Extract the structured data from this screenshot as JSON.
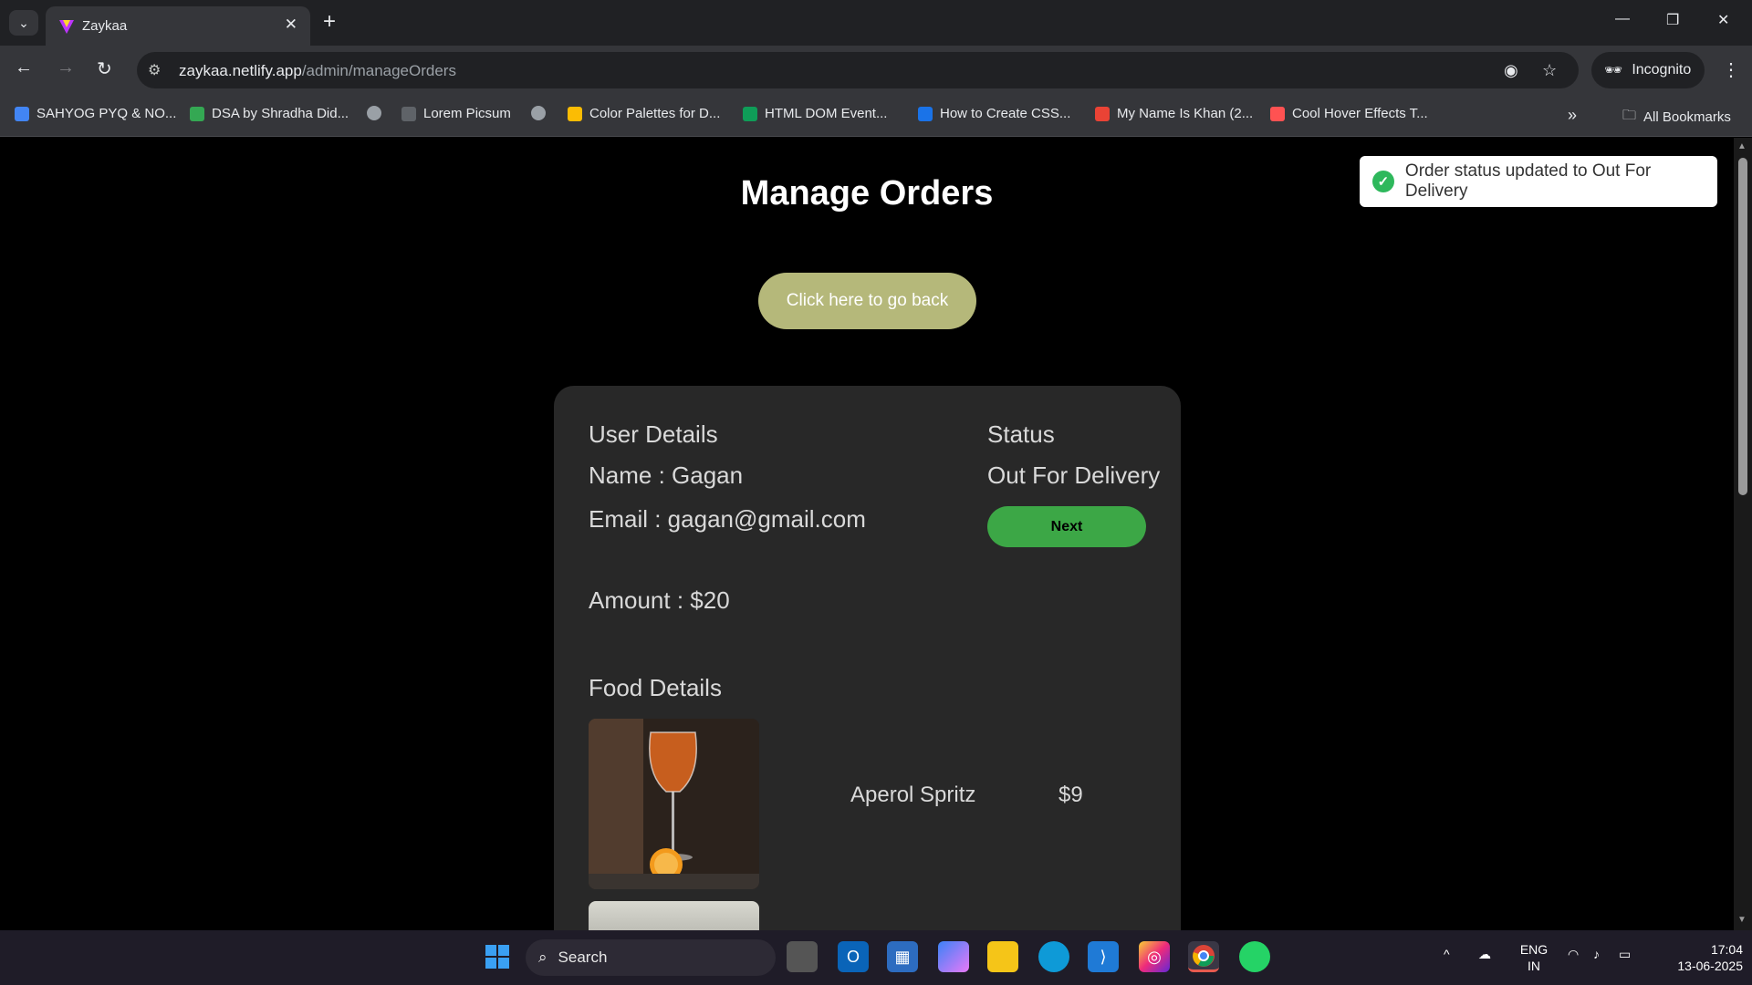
{
  "browser": {
    "tab_title": "Zaykaa",
    "url_host": "zaykaa.netlify.app",
    "url_path": "/admin/manageOrders",
    "incognito_label": "Incognito",
    "all_bookmarks_label": "All Bookmarks",
    "bookmarks": [
      {
        "label": "SAHYOG PYQ & NO...",
        "color": "#4285f4"
      },
      {
        "label": "DSA by Shradha Did...",
        "color": "#34a853"
      },
      {
        "label": "",
        "color": "#9aa0a6"
      },
      {
        "label": "Lorem Picsum",
        "color": "#5f6368"
      },
      {
        "label": "",
        "color": "#9aa0a6"
      },
      {
        "label": "Color Palettes for D...",
        "color": "#fbbc04"
      },
      {
        "label": "HTML DOM Event...",
        "color": "#0f9d58"
      },
      {
        "label": "How to Create CSS...",
        "color": "#1a73e8"
      },
      {
        "label": "My Name Is Khan (2...",
        "color": "#ea4335"
      },
      {
        "label": "Cool Hover Effects T...",
        "color": "#ff5252"
      }
    ]
  },
  "page": {
    "title": "Manage Orders",
    "back_button": "Click here to go back",
    "toast": "Order status updated to Out For Delivery"
  },
  "order": {
    "user_details_heading": "User Details",
    "name_line": "Name : Gagan",
    "email_line": "Email : gagan@gmail.com",
    "amount_line": "Amount : $20",
    "status_heading": "Status",
    "status_value": "Out For Delivery",
    "next_button": "Next",
    "food_heading": "Food Details",
    "items": [
      {
        "name": "Aperol Spritz",
        "price": "$9"
      }
    ]
  },
  "taskbar": {
    "search_label": "Search",
    "lang_top": "ENG",
    "lang_bottom": "IN",
    "time": "17:04",
    "date": "13-06-2025"
  },
  "colors": {
    "accent_back": "#b5b87a",
    "accent_next": "#3ca746",
    "card_bg": "#282828"
  }
}
